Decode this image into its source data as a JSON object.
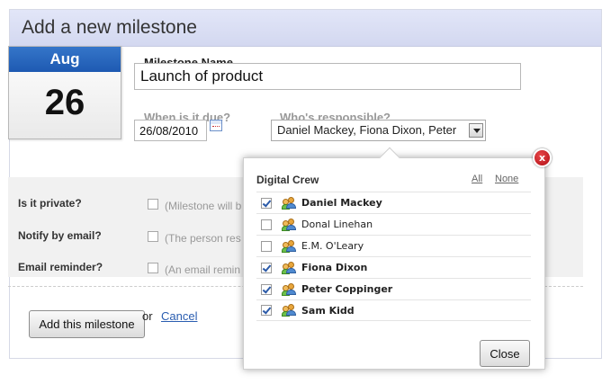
{
  "dialog": {
    "title": "Add a new milestone"
  },
  "calendar": {
    "month": "Aug",
    "day": "26"
  },
  "milestone_name": {
    "label": "Milestone Name",
    "value": "Launch of product"
  },
  "due": {
    "label": "When is it due?",
    "value": "26/08/2010"
  },
  "responsible": {
    "label": "Who's responsible?",
    "value": "Daniel Mackey, Fiona Dixon, Peter"
  },
  "options": [
    {
      "label": "Is it private?",
      "text": "(Milestone will b",
      "checked": false
    },
    {
      "label": "Notify by email?",
      "text": "(The person res",
      "checked": false
    },
    {
      "label": "Email reminder?",
      "text": "(An email remin",
      "checked": false
    }
  ],
  "actions": {
    "submit_label": "Add this milestone",
    "or_text": "or",
    "cancel_label": "Cancel"
  },
  "popup": {
    "group_name": "Digital Crew",
    "all_label": "All",
    "none_label": "None",
    "close_label": "Close",
    "close_x": "x",
    "people": [
      {
        "name": "Daniel Mackey",
        "checked": true
      },
      {
        "name": "Donal Linehan",
        "checked": false
      },
      {
        "name": "E.M. O'Leary",
        "checked": false
      },
      {
        "name": "Fiona Dixon",
        "checked": true
      },
      {
        "name": "Peter Coppinger",
        "checked": true
      },
      {
        "name": "Sam Kidd",
        "checked": true
      }
    ]
  },
  "colors": {
    "accent": "#1e5ab2",
    "header_bg": "#d3d8f0",
    "link": "#2a5db0",
    "close_red": "#b10d13"
  }
}
